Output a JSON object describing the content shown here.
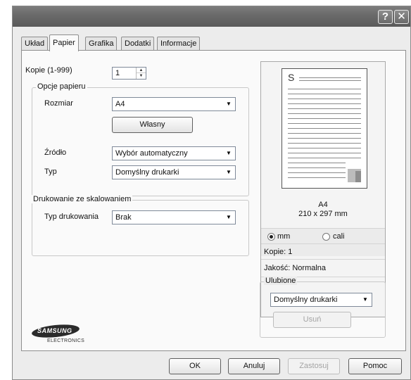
{
  "titlebar": {
    "help_glyph": "?",
    "close_glyph": "✕"
  },
  "tabs": [
    {
      "label": "Układ"
    },
    {
      "label": "Papier",
      "active": true
    },
    {
      "label": "Grafika"
    },
    {
      "label": "Dodatki"
    },
    {
      "label": "Informacje"
    }
  ],
  "copies": {
    "label": "Kopie (1-999)",
    "value": "1"
  },
  "paper_options": {
    "group_title": "Opcje papieru",
    "size_label": "Rozmiar",
    "size_value": "A4",
    "custom_button": "Własny",
    "source_label": "Źródło",
    "source_value": "Wybór automatyczny",
    "type_label": "Typ",
    "type_value": "Domyślny drukarki"
  },
  "scaling": {
    "group_title": "Drukowanie ze skalowaniem",
    "type_label": "Typ drukowania",
    "type_value": "Brak"
  },
  "preview": {
    "page_letter": "S",
    "paper_name": "A4",
    "paper_dims": "210 x 297 mm",
    "unit_mm": "mm",
    "unit_inch": "cali",
    "copies_text": "Kopie: 1",
    "quality_text": "Jakość: Normalna"
  },
  "favorites": {
    "group_title": "Ulubione",
    "value": "Domyślny drukarki",
    "delete_button": "Usuń"
  },
  "logo": {
    "brand": "SAMSUNG",
    "sub": "ELECTRONICS"
  },
  "buttons": {
    "ok": "OK",
    "cancel": "Anuluj",
    "apply": "Zastosuj",
    "help": "Pomoc"
  },
  "icons": {
    "dropdown": "chevron-down-icon",
    "spin_up": "arrow-up-icon",
    "spin_down": "arrow-down-icon"
  }
}
